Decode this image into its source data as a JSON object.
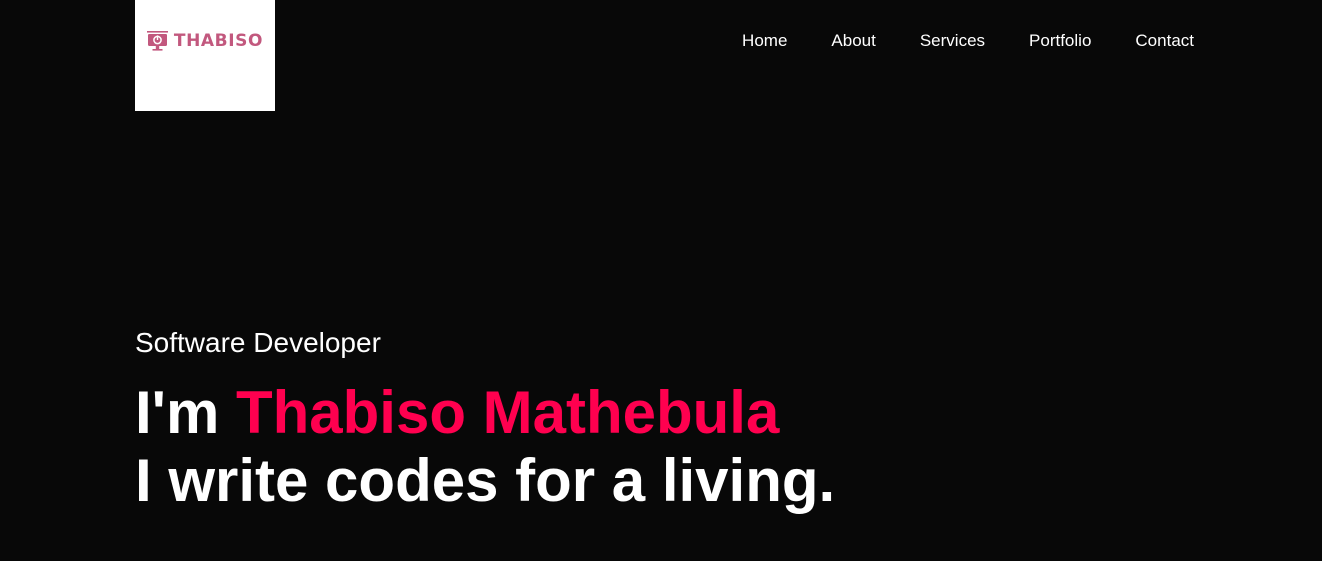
{
  "brand": {
    "logo_text": "THABISO",
    "logo_icon": "monitor-power-icon",
    "logo_color": "#c2587e"
  },
  "nav": {
    "items": [
      "Home",
      "About",
      "Services",
      "Portfolio",
      "Contact"
    ]
  },
  "hero": {
    "subtitle": "Software Developer",
    "greeting": "I'm ",
    "name": "Thabiso Mathebula",
    "tagline": "I write codes for a living."
  },
  "colors": {
    "background": "#080808",
    "accent": "#ff004f",
    "text": "#ffffff"
  }
}
